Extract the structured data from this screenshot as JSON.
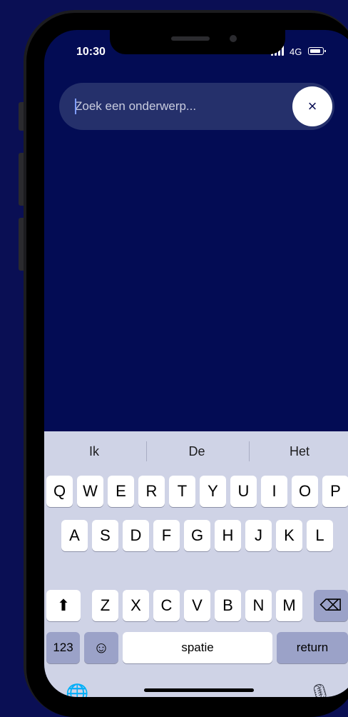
{
  "status": {
    "time": "10:30",
    "network": "4G"
  },
  "search": {
    "placeholder": "Zoek een onderwerp...",
    "value": "",
    "clear_icon": "×"
  },
  "keyboard": {
    "suggestions": [
      "Ik",
      "De",
      "Het"
    ],
    "row1": [
      "Q",
      "W",
      "E",
      "R",
      "T",
      "Y",
      "U",
      "I",
      "O",
      "P"
    ],
    "row2": [
      "A",
      "S",
      "D",
      "F",
      "G",
      "H",
      "J",
      "K",
      "L"
    ],
    "row3": [
      "Z",
      "X",
      "C",
      "V",
      "B",
      "N",
      "M"
    ],
    "shift_icon": "⬆",
    "delete_icon": "⌫",
    "numbers_label": "123",
    "emoji_icon": "☺",
    "space_label": "spatie",
    "return_label": "return",
    "globe_icon": "🌐",
    "mic_icon": "🎙"
  },
  "colors": {
    "background": "#0a0f54",
    "screen": "#030c54",
    "search_bg": "#25306b",
    "keyboard_bg": "#cfd3e6"
  }
}
